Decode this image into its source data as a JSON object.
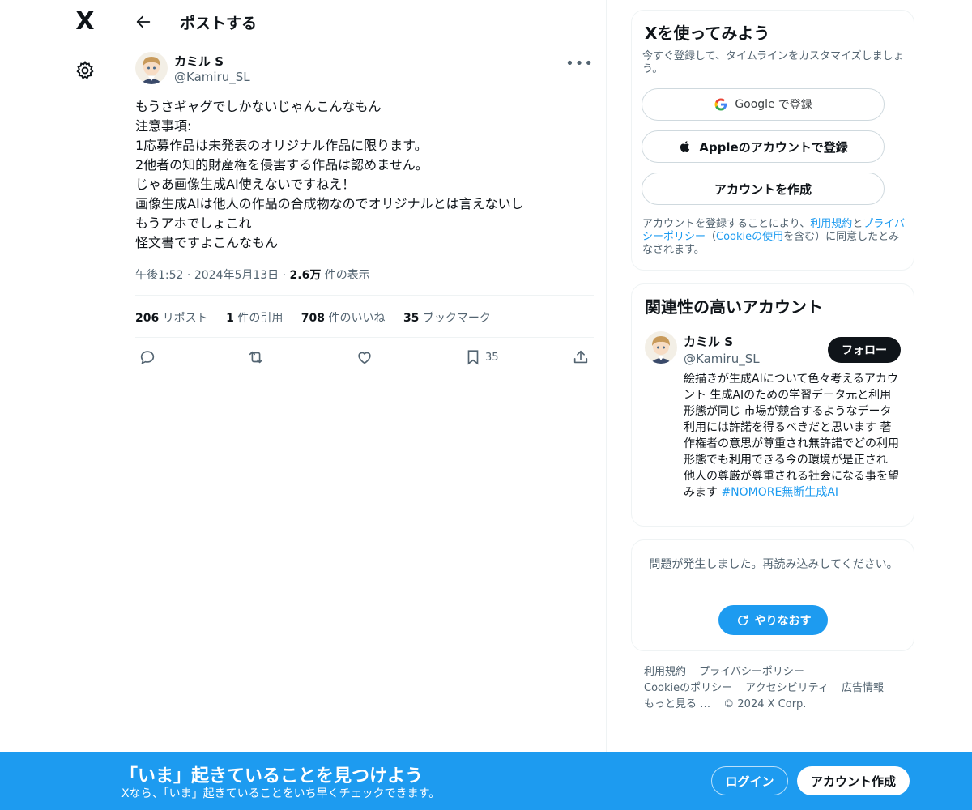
{
  "nav": {
    "logo": "X"
  },
  "header": {
    "title": "ポストする"
  },
  "post": {
    "author_name": "カミル S",
    "author_handle": "@Kamiru_SL",
    "more_label": "•••",
    "lines": [
      "もうさギャグでしかないじゃんこんなもん",
      "注意事項:",
      "1応募作品は未発表のオリジナル作品に限ります。",
      "2他者の知的財産権を侵害する作品は認めません。",
      "じゃあ画像生成AI使えないですねえ！",
      "画像生成AIは他人の作品の合成物なのでオリジナルとは言えないし",
      "もうアホでしょこれ",
      "怪文書ですよこんなもん"
    ],
    "time": "午後1:52",
    "date": "2024年5月13日",
    "views_count": "2.6万",
    "views_label": "件の表示",
    "sep": "·",
    "stats": {
      "reposts_count": "206",
      "reposts_label": "リポスト",
      "quotes_count": "1",
      "quotes_label": "件の引用",
      "likes_count": "708",
      "likes_label": "件のいいね",
      "bookmarks_count": "35",
      "bookmarks_label": "ブックマーク"
    },
    "bookmark_action_count": "35"
  },
  "signup_card": {
    "title": "Xを使ってみよう",
    "subtitle": "今すぐ登録して、タイムラインをカスタマイズしましょう。",
    "google_brand": "Google",
    "google_label": "で登録",
    "apple_label": "Appleのアカウントで登録",
    "create_label": "アカウントを作成",
    "legal_prefix": "アカウントを登録することにより、",
    "terms": "利用規約",
    "and": "と",
    "privacy": "プライバシーポリシー",
    "paren_open": "（",
    "cookie": "Cookieの使用",
    "legal_suffix": "を含む）に同意したとみなされます。"
  },
  "related_card": {
    "title": "関連性の高いアカウント",
    "name": "カミル S",
    "handle": "@Kamiru_SL",
    "follow_label": "フォロー",
    "bio": "絵描きが生成AIについて色々考えるアカウント 生成AIのための学習データ元と利用形態が同じ 市場が競合するようなデータ利用には許諾を得るべきだと思います 著作権者の意思が尊重され無許諾でどの利用形態でも利用できる今の環境が是正され 他人の尊厳が尊重される社会になる事を望みます ",
    "hashtag": "#NOMORE無断生成AI"
  },
  "error_card": {
    "message": "問題が発生しました。再読み込みしてください。",
    "retry_label": "やりなおす"
  },
  "footer": {
    "links": [
      "利用規約",
      "プライバシーポリシー",
      "Cookieのポリシー",
      "アクセシビリティ",
      "広告情報",
      "もっと見る …",
      "© 2024 X Corp."
    ]
  },
  "banner": {
    "title": "「いま」起きていることを見つけよう",
    "subtitle": "Xなら、「いま」起きていることをいち早くチェックできます。",
    "login_label": "ログイン",
    "signup_label": "アカウント作成"
  },
  "colors": {
    "accent": "#1d9bf0",
    "text": "#0f1419",
    "muted": "#536471",
    "border": "#eff3f4"
  }
}
